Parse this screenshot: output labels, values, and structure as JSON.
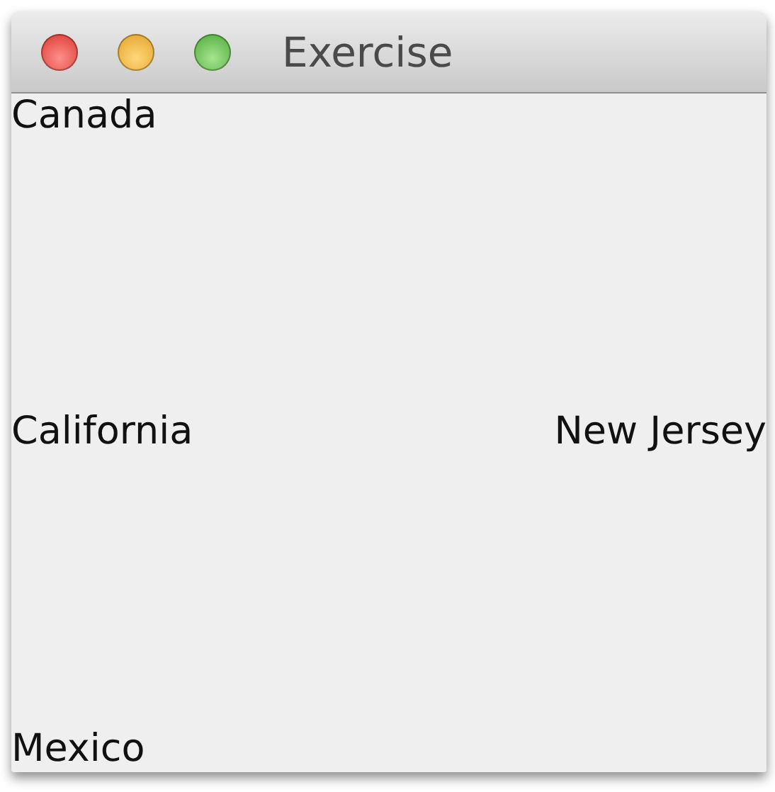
{
  "window": {
    "title": "Exercise"
  },
  "labels": {
    "north": "Canada",
    "west": "California",
    "east": "New Jersey",
    "south": "Mexico"
  }
}
